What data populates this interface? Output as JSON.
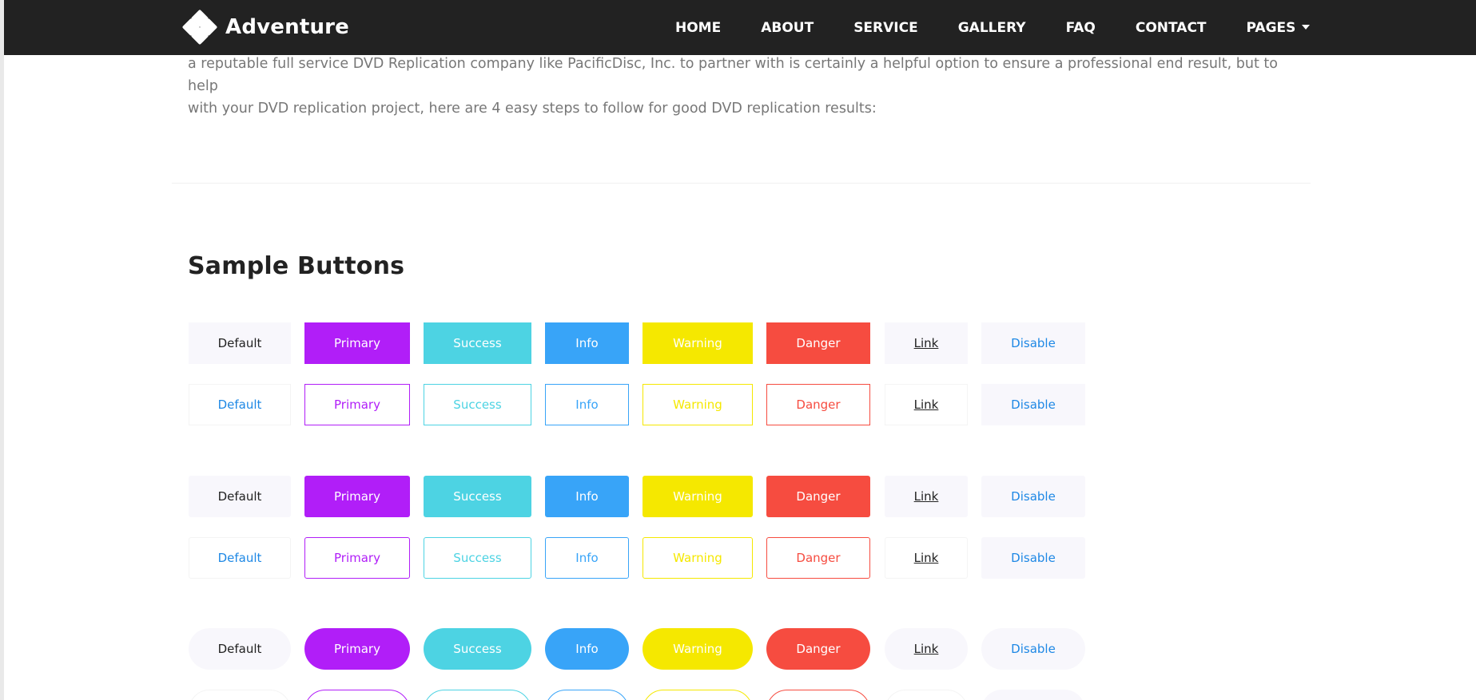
{
  "header": {
    "brand": "Adventure",
    "nav": [
      "HOME",
      "ABOUT",
      "SERVICE",
      "GALLERY",
      "FAQ",
      "CONTACT",
      "PAGES"
    ]
  },
  "content": {
    "intro_line1": "a reputable full service DVD Replication company like PacificDisc, Inc. to partner with is certainly a helpful option to ensure a professional end result, but to help",
    "intro_line2": "with your DVD replication project, here are 4 easy steps to follow for good DVD replication results:",
    "section_title": "Sample Buttons"
  },
  "buttons": {
    "default": "Default",
    "primary": "Primary",
    "success": "Success",
    "info": "Info",
    "warning": "Warning",
    "danger": "Danger",
    "link": "Link",
    "disable": "Disable"
  },
  "colors": {
    "primary": "#b11ef8",
    "success": "#4dd3e3",
    "info": "#38a4f8",
    "warning": "#f5e800",
    "danger": "#f64c40",
    "link_blue": "#1e88e5",
    "header_bg": "#222222"
  }
}
